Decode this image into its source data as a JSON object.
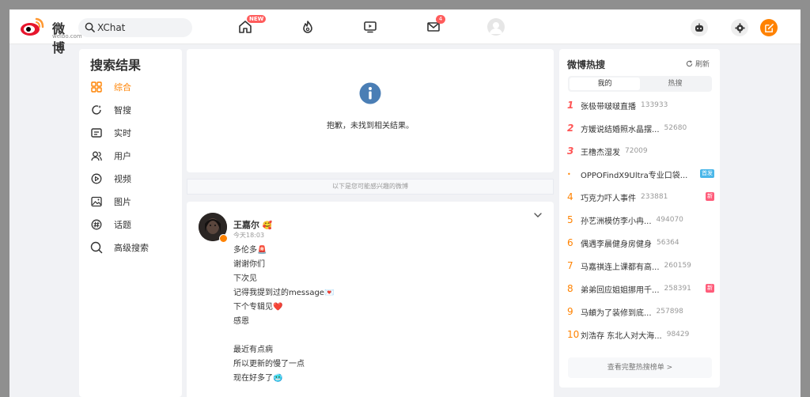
{
  "topbar": {
    "logo_text": "微博",
    "logo_sub": "weibo.com",
    "search_value": "XChat",
    "new_badge": "NEW",
    "mail_count": "4"
  },
  "leftnav": {
    "title": "搜索结果",
    "items": [
      {
        "label": "综合",
        "icon": "grid-icon",
        "active": true
      },
      {
        "label": "智搜",
        "icon": "smart-search-icon"
      },
      {
        "label": "实时",
        "icon": "realtime-icon"
      },
      {
        "label": "用户",
        "icon": "users-icon"
      },
      {
        "label": "视频",
        "icon": "video-play-icon"
      },
      {
        "label": "图片",
        "icon": "image-icon"
      },
      {
        "label": "话题",
        "icon": "topic-hash-icon"
      },
      {
        "label": "高级搜索",
        "icon": "advanced-search-icon"
      }
    ]
  },
  "empty": {
    "message": "抱歉，未找到相关结果。"
  },
  "suggest_bar": "以下是您可能感兴趣的微博",
  "post": {
    "name": "王嘉尔",
    "time": "今天18:03",
    "lines": [
      "多伦多🚨",
      "谢谢你们",
      "下次见",
      "记得我提到过的message💌",
      "下个专辑见❤️",
      "感恩",
      "",
      "最近有点病",
      "所以更新的慢了一点",
      "现在好多了🥶"
    ]
  },
  "hot": {
    "title": "微博热搜",
    "refresh": "刷新",
    "tab_mine": "我的",
    "tab_hot": "热搜",
    "rows": [
      {
        "rank": "1",
        "title": "张极带啵啵直播",
        "heat": "133933",
        "tag": ""
      },
      {
        "rank": "2",
        "title": "方媛说结婚照水晶摆...",
        "heat": "52680",
        "tag": ""
      },
      {
        "rank": "3",
        "title": "王橹杰湿发",
        "heat": "72009",
        "tag": ""
      },
      {
        "rank": "•",
        "title": "OPPOFindX9Ultra专业口袋...",
        "heat": "",
        "tag": "首发"
      },
      {
        "rank": "4",
        "title": "巧克力吓人事件",
        "heat": "233881",
        "tag": "新"
      },
      {
        "rank": "5",
        "title": "孙艺洲模仿李小冉...",
        "heat": "494070",
        "tag": ""
      },
      {
        "rank": "6",
        "title": "偶遇李晨健身房健身",
        "heat": "56364",
        "tag": ""
      },
      {
        "rank": "7",
        "title": "马嘉祺连上课都有高...",
        "heat": "260159",
        "tag": ""
      },
      {
        "rank": "8",
        "title": "弟弟回应姐姐挪用千...",
        "heat": "258391",
        "tag": "新"
      },
      {
        "rank": "9",
        "title": "马頔为了装修到底...",
        "heat": "257898",
        "tag": ""
      },
      {
        "rank": "10",
        "title": "刘浩存 东北人对大海...",
        "heat": "98429",
        "tag": ""
      }
    ],
    "more": "查看完整热搜榜单 >"
  },
  "colors": {
    "accent": "#ff8200",
    "hot_red": "#ff5c5c",
    "tag_blue": "#4ab7e9",
    "tag_new": "#ff5c7a"
  }
}
